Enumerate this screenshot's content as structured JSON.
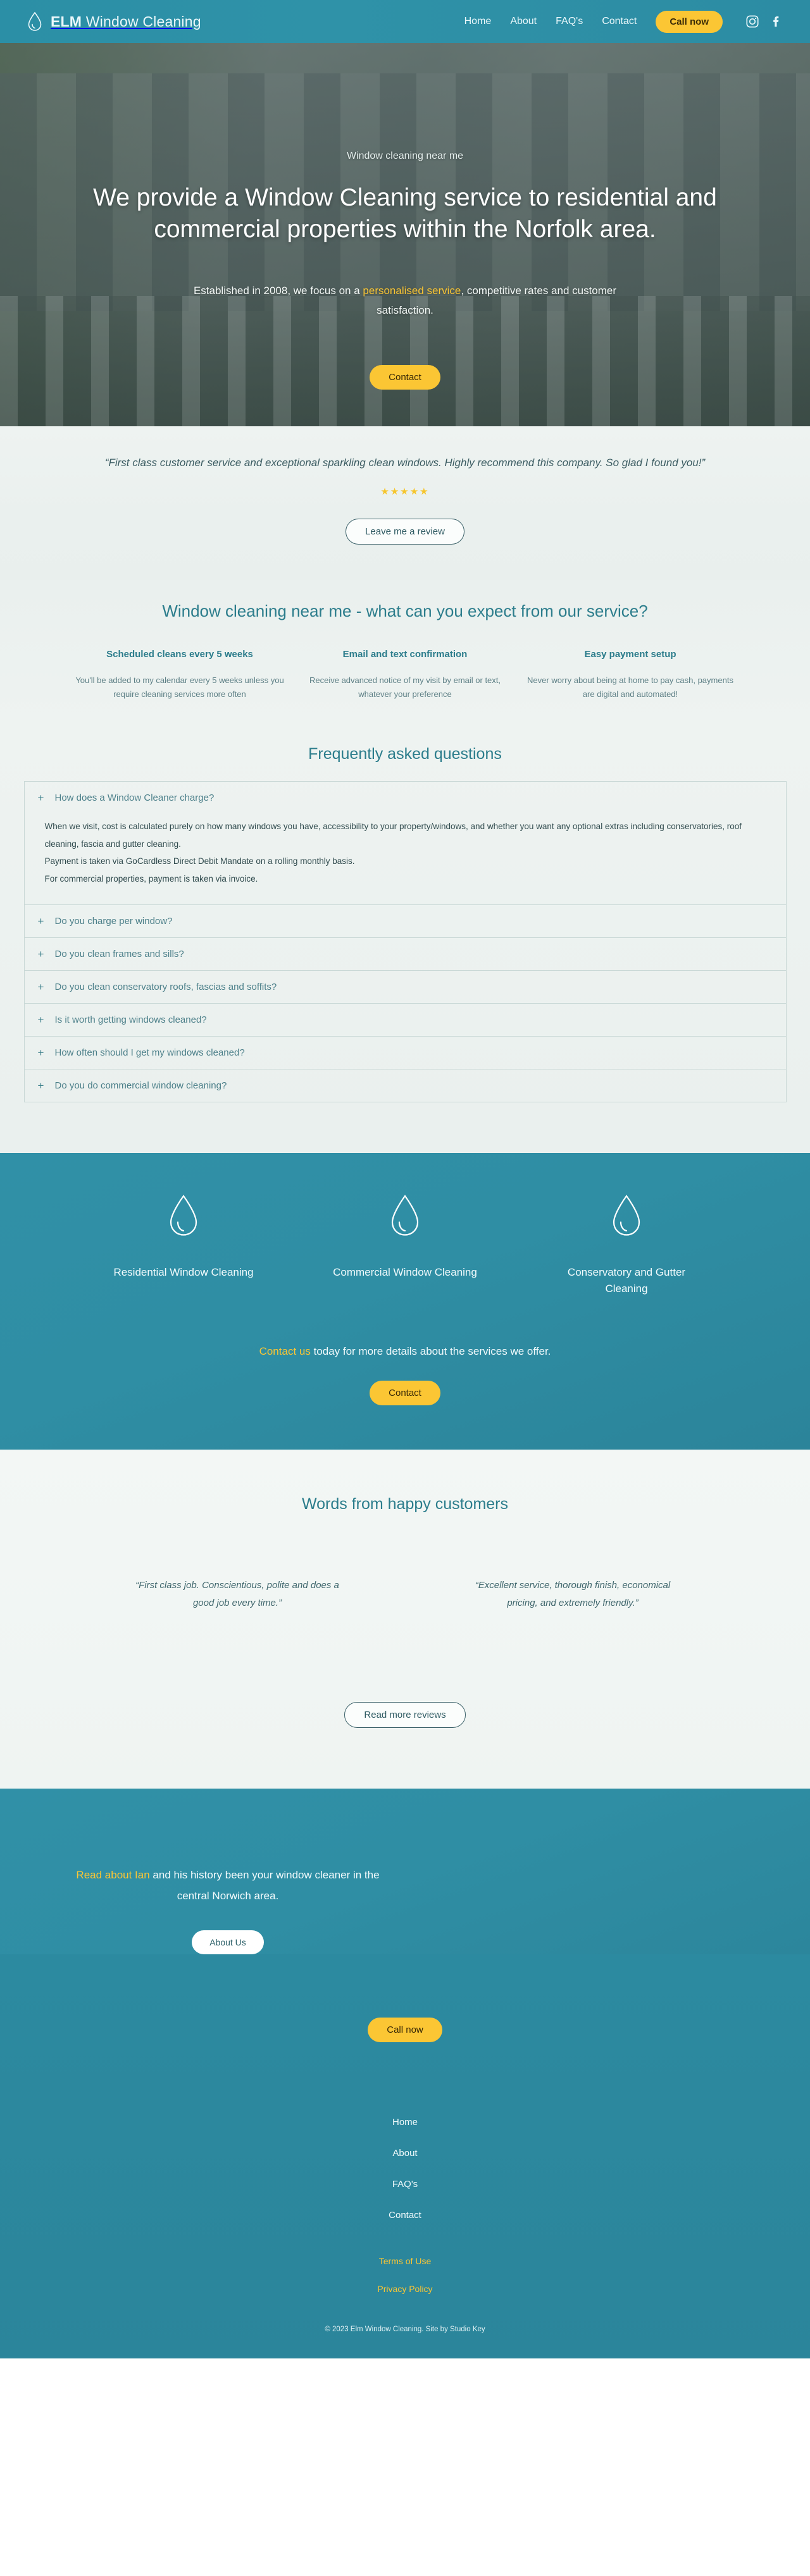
{
  "theme": {
    "teal": "#2f8ea4",
    "yellow": "#fbc634",
    "heading_teal": "#2c7d8c",
    "body_text": "#5d7f85",
    "light_bg": "#eef3f1"
  },
  "header": {
    "brand_bold": "ELM",
    "brand_light": " Window Cleaning",
    "logo_icon": "water-drop-icon",
    "nav": [
      {
        "label": "Home"
      },
      {
        "label": "About"
      },
      {
        "label": "FAQ's"
      },
      {
        "label": "Contact"
      }
    ],
    "call_label": "Call now",
    "social": [
      {
        "name": "instagram-icon"
      },
      {
        "name": "facebook-icon"
      }
    ]
  },
  "hero": {
    "eyebrow": "Window cleaning near me",
    "title": "We provide a Window Cleaning service to residential and commercial properties within the Norfolk area.",
    "sub_before": "Established in 2008, we focus on a ",
    "sub_link": "personalised service",
    "sub_after": ", competitive rates and customer satisfaction.",
    "cta_label": "Contact"
  },
  "review_band": {
    "quote": "“First class customer service and exceptional sparkling clean windows. Highly recommend this company. So glad I found you!”",
    "stars": "★★★★★",
    "stars_count": 5,
    "button_label": "Leave me a review"
  },
  "expect": {
    "title": "Window cleaning near me - what can you expect from our service?",
    "columns": [
      {
        "heading": "Scheduled cleans every 5 weeks",
        "body": "You'll be added to my calendar every 5 weeks unless you require cleaning services more often"
      },
      {
        "heading": "Email and text confirmation",
        "body": "Receive advanced notice of my visit by email or text, whatever your preference"
      },
      {
        "heading": "Easy payment setup",
        "body": "Never worry about being at home to pay cash, payments are digital and automated!"
      }
    ]
  },
  "faq": {
    "title": "Frequently asked questions",
    "plus_icon": "+",
    "items": [
      {
        "question": "How does a Window Cleaner charge?",
        "open": true,
        "answer_lines": [
          "When we visit, cost is calculated purely on how many windows you have, accessibility to your property/windows, and whether you want any optional extras including conservatories, roof cleaning, fascia and gutter cleaning.",
          "Payment is taken via GoCardless Direct Debit Mandate on a rolling monthly basis.",
          "For commercial properties, payment is taken via invoice."
        ]
      },
      {
        "question": "Do you charge per window?",
        "open": false
      },
      {
        "question": "Do you clean frames and sills?",
        "open": false
      },
      {
        "question": "Do you clean conservatory roofs, fascias and soffits?",
        "open": false
      },
      {
        "question": "Is it worth getting windows cleaned?",
        "open": false
      },
      {
        "question": "How often should I get my windows cleaned?",
        "open": false
      },
      {
        "question": "Do you do commercial window cleaning?",
        "open": false
      }
    ]
  },
  "services": {
    "items": [
      {
        "icon": "water-drop-icon",
        "label": "Residential Window Cleaning"
      },
      {
        "icon": "water-drop-icon",
        "label": "Commercial Window Cleaning"
      },
      {
        "icon": "water-drop-icon",
        "label": "Conservatory and Gutter Cleaning"
      }
    ],
    "cta_link": "Contact us",
    "cta_rest": " today for more details about the services we offer.",
    "button_label": "Contact"
  },
  "testimonials": {
    "title": "Words from happy customers",
    "quotes": [
      "“First class job. Conscientious, polite and does a good job every time.”",
      "“Excellent service, thorough finish, economical pricing, and extremely friendly.”"
    ],
    "button_label": "Read more reviews"
  },
  "about": {
    "link": "Read about Ian",
    "rest": " and his history been your window cleaner in the central Norwich area.",
    "button_label": "About Us"
  },
  "footer": {
    "call_label": "Call now",
    "nav": [
      {
        "label": "Home"
      },
      {
        "label": "About"
      },
      {
        "label": "FAQ's"
      },
      {
        "label": "Contact"
      }
    ],
    "legal": [
      {
        "label": "Terms of Use"
      },
      {
        "label": "Privacy Policy"
      }
    ],
    "copyright": "© 2023 Elm Window Cleaning. Site by Studio Key"
  }
}
